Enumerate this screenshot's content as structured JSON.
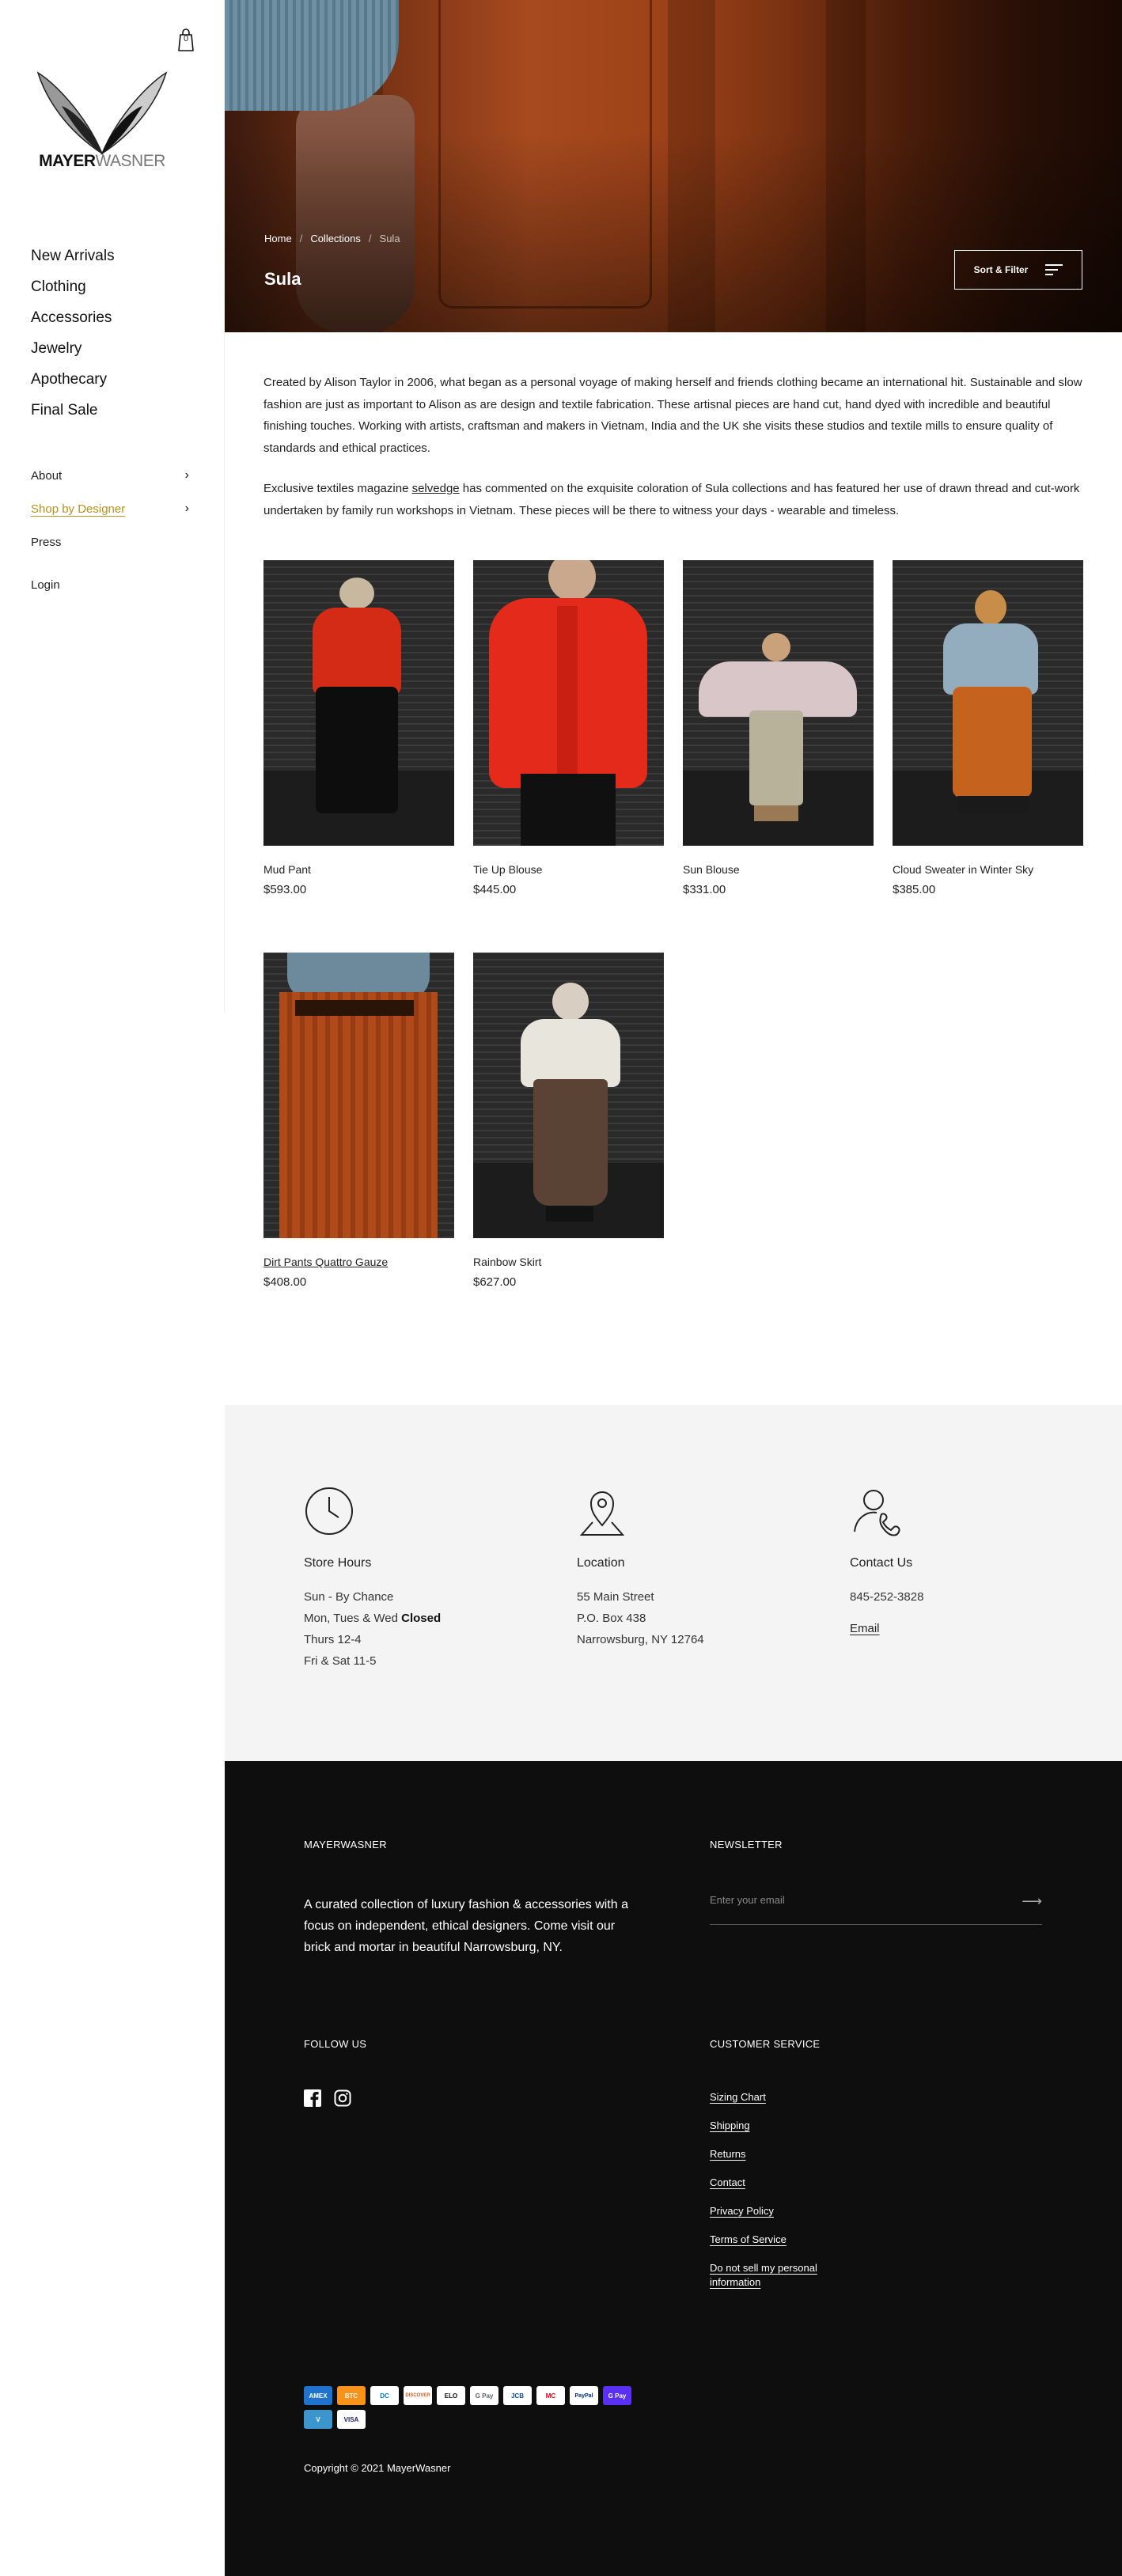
{
  "cart": {
    "count": "0"
  },
  "logo": {
    "part1": "MAYER",
    "part2": "WASNER"
  },
  "main_nav": [
    "New Arrivals",
    "Clothing",
    "Accessories",
    "Jewelry",
    "Apothecary",
    "Final Sale"
  ],
  "sub_nav": {
    "about": "About",
    "shop_by_designer": "Shop by Designer",
    "press": "Press",
    "login": "Login"
  },
  "breadcrumb": {
    "home": "Home",
    "collections": "Collections",
    "current": "Sula"
  },
  "collection": {
    "title": "Sula",
    "sort_filter": "Sort & Filter"
  },
  "description": {
    "p1": "Created by Alison Taylor in 2006, what began as a personal voyage of making herself and friends clothing became an international hit. Sustainable and slow fashion are just as important to Alison as are design and textile fabrication. These artisnal pieces are hand cut, hand dyed with incredible and beautiful finishing touches. Working with artists, craftsman and makers in Vietnam, India and the UK she visits these studios and textile mills to ensure quality of standards and ethical practices.",
    "p2_before": "Exclusive textiles magazine ",
    "p2_link": "selvedge",
    "p2_after": " has commented on the exquisite coloration of Sula collections and has featured her use of drawn thread and cut-work undertaken by family run workshops in Vietnam. These pieces will be there to witness your days - wearable and timeless."
  },
  "products": [
    {
      "name": "Mud Pant",
      "price": "$593.00"
    },
    {
      "name": "Tie Up Blouse",
      "price": "$445.00"
    },
    {
      "name": "Sun Blouse",
      "price": "$331.00"
    },
    {
      "name": "Cloud Sweater in Winter Sky",
      "price": "$385.00"
    },
    {
      "name": "Dirt Pants Quattro Gauze",
      "price": "$408.00"
    },
    {
      "name": "Rainbow Skirt",
      "price": "$627.00"
    }
  ],
  "store_hours": {
    "title": "Store Hours",
    "l1": "Sun - By Chance",
    "l2a": "Mon, Tues & Wed ",
    "l2b": "Closed",
    "l3": "Thurs 12-4",
    "l4": "Fri & Sat 11-5"
  },
  "location": {
    "title": "Location",
    "l1": "55 Main Street",
    "l2": "P.O. Box 438",
    "l3": "Narrowsburg, NY 12764"
  },
  "contact": {
    "title": "Contact Us",
    "phone": "845-252-3828",
    "email": "Email"
  },
  "footer": {
    "brand_heading": "MAYERWASNER",
    "about": "A curated collection of luxury fashion & accessories with a focus on independent, ethical designers. Come visit our brick and mortar in beautiful Narrowsburg, NY.",
    "newsletter_heading": "NEWSLETTER",
    "newsletter_placeholder": "Enter your email",
    "follow_heading": "FOLLOW US",
    "cs_heading": "CUSTOMER SERVICE",
    "cs_links": [
      "Sizing Chart",
      "Shipping",
      "Returns",
      "Contact",
      "Privacy Policy",
      "Terms of Service",
      "Do not sell my personal information"
    ],
    "payments": [
      "AMEX",
      "BTC",
      "DC",
      "DISCOVER",
      "ELO",
      "G Pay",
      "JCB",
      "MC",
      "PayPal",
      "G Pay",
      "V",
      "VISA"
    ],
    "copyright": "Copyright © 2021 MayerWasner"
  },
  "colors": {
    "accent_gold": "#b8901f",
    "footer_bg": "#0e0e0f",
    "info_bg": "#f4f4f4"
  }
}
